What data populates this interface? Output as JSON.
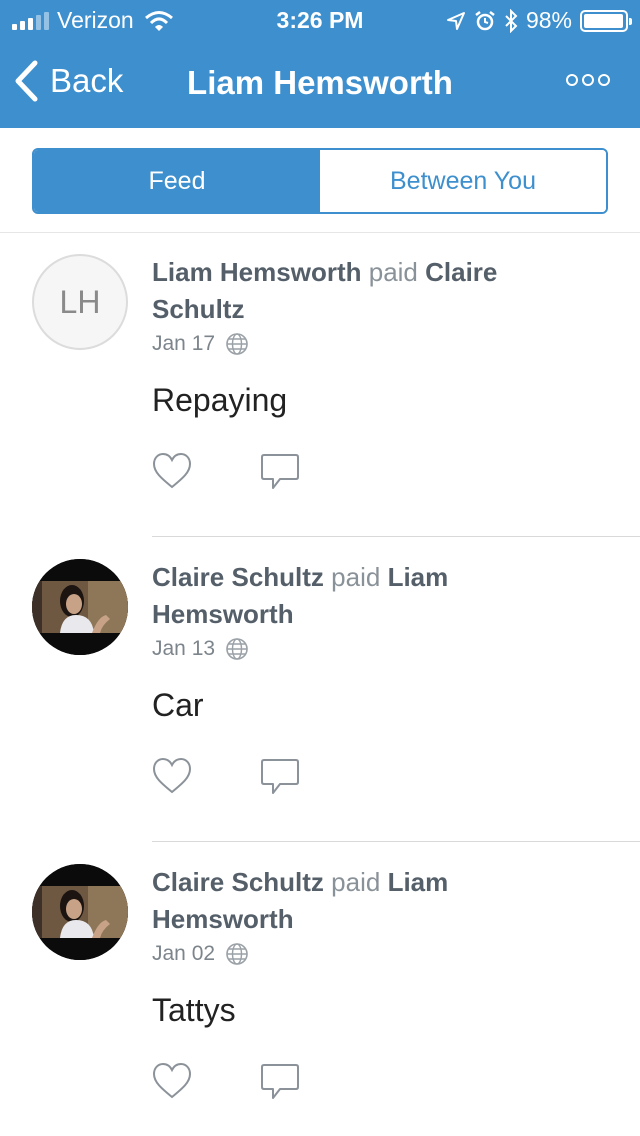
{
  "status_bar": {
    "carrier": "Verizon",
    "time": "3:26 PM",
    "battery_percent": "98%",
    "battery_level": 0.98,
    "icons": [
      "signal-icon",
      "wifi-icon",
      "location-arrow-icon",
      "alarm-icon",
      "bluetooth-icon",
      "battery-icon"
    ]
  },
  "nav": {
    "back_label": "Back",
    "title": "Liam Hemsworth",
    "more_icon": "more-icon"
  },
  "tabs": [
    {
      "label": "Feed",
      "active": true
    },
    {
      "label": "Between You",
      "active": false
    }
  ],
  "feed": [
    {
      "avatar_initials": "LH",
      "payer": "Liam Hemsworth",
      "verb": "paid",
      "payee": "Claire Schultz",
      "date": "Jan 17",
      "note": "Repaying"
    },
    {
      "avatar_initials": "",
      "payer": "Claire Schultz",
      "verb": "paid",
      "payee": "Liam Hemsworth",
      "date": "Jan 13",
      "note": "Car"
    },
    {
      "avatar_initials": "",
      "payer": "Claire Schultz",
      "verb": "paid",
      "payee": "Liam Hemsworth",
      "date": "Jan 02",
      "note": "Tattys"
    }
  ],
  "colors": {
    "brand_blue": "#3d8fce",
    "text_dark": "#222222",
    "text_gray": "#5d6872"
  }
}
